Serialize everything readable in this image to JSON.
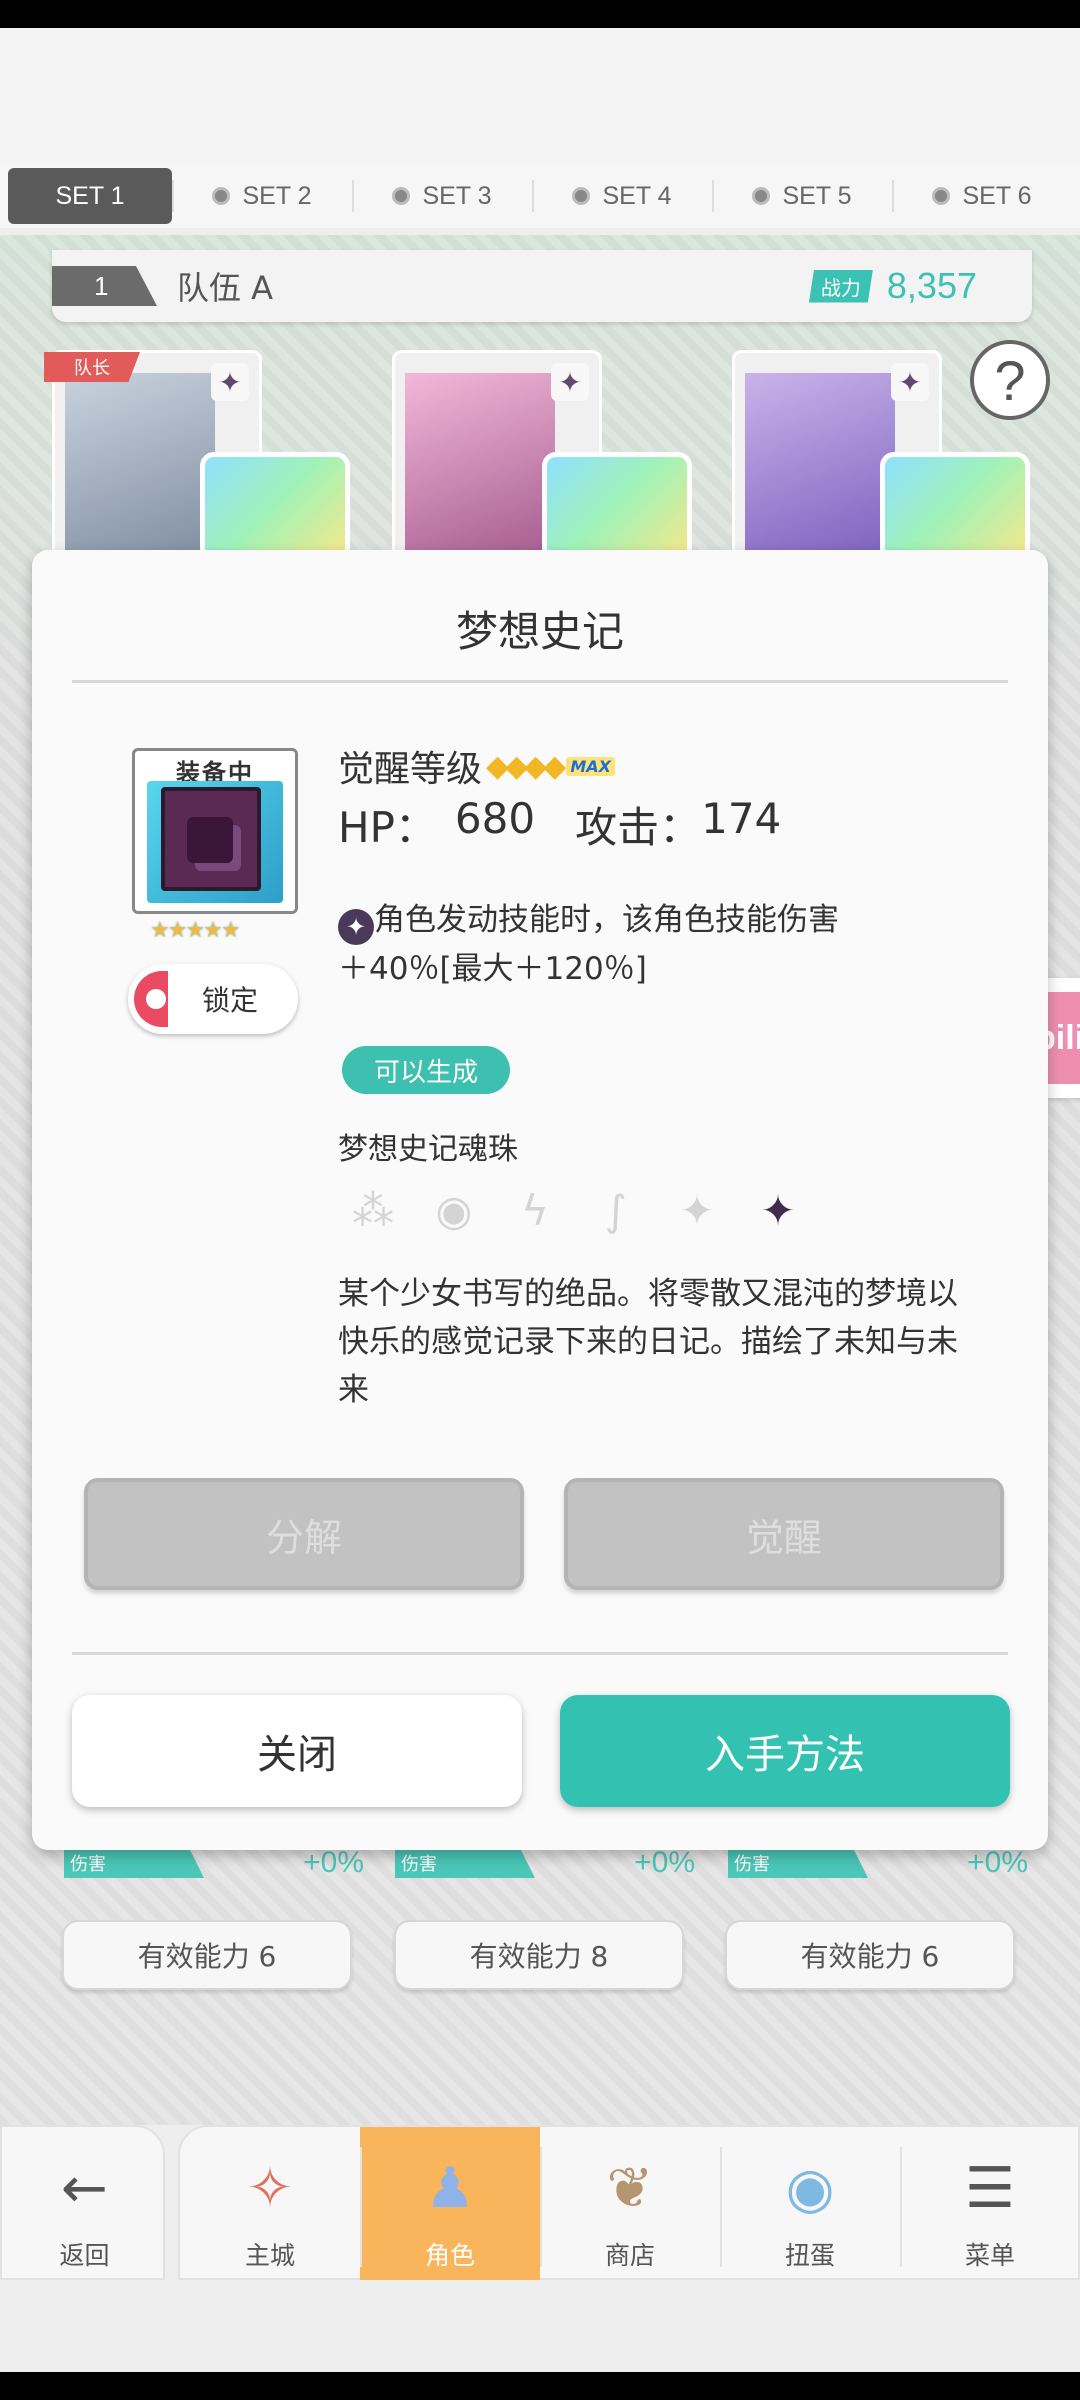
{
  "set_tabs": [
    "SET 1",
    "SET 2",
    "SET 3",
    "SET 4",
    "SET 5",
    "SET 6"
  ],
  "team": {
    "number": "1",
    "name": "队伍 A",
    "power_label": "战力",
    "power_value": "8,357",
    "leader_tag": "队长"
  },
  "help_icon": "?",
  "side_tab_text": "bili",
  "stat_rows": [
    {
      "label": "伤害",
      "value": "+0%"
    },
    {
      "label": "伤害",
      "value": "+0%"
    },
    {
      "label": "伤害",
      "value": "+0%"
    }
  ],
  "effective": [
    "有效能力 6",
    "有效能力 8",
    "有效能力 6"
  ],
  "dialog": {
    "title": "梦想史记",
    "equipped_label": "装备中",
    "stars": "★★★★★",
    "lock_label": "锁定",
    "awaken_label": "觉醒等级",
    "awaken_max": "MAX",
    "hp_label": "HP：",
    "hp_value": "680",
    "atk_label": "攻击：",
    "atk_value": "174",
    "skill_line1": "角色发动技能时，该角色技能伤害",
    "skill_line2": "＋40％[最大＋120％]",
    "craftable": "可以生成",
    "soul_label": "梦想史记魂珠",
    "description": "某个少女书写的绝品。将零散又混沌的梦境以快乐的感觉记录下来的日记。描绘了未知与未来",
    "decompose": "分解",
    "awaken_btn": "觉醒",
    "close": "关闭",
    "obtain": "入手方法"
  },
  "nav": {
    "back": "返回",
    "items": [
      "主城",
      "角色",
      "商店",
      "扭蛋",
      "菜单"
    ]
  },
  "colors": {
    "accent": "#33c2b2",
    "active_nav": "#f8b55b",
    "lock": "#ea4b63"
  }
}
